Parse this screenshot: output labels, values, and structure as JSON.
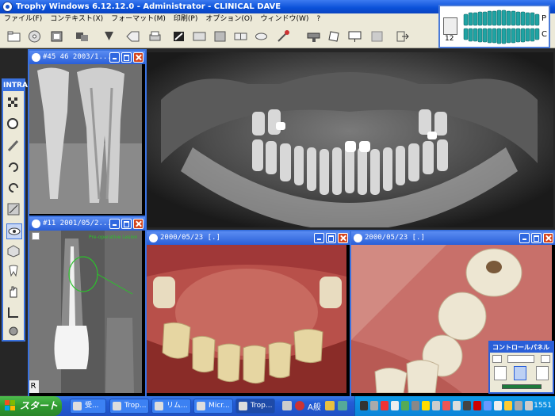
{
  "app": {
    "title": "Trophy Windows 6.12.12.0 - Administrator - CLINICAL DAVE"
  },
  "menu": [
    "ファイル(F)",
    "コンテキスト(X)",
    "フォーマット(M)",
    "印刷(P)",
    "オプション(O)",
    "ウィンドウ(W)",
    "?"
  ],
  "chart_panel": {
    "number": "12",
    "upper_label": "P",
    "lower_label": "C"
  },
  "intra": {
    "title": "INTRA"
  },
  "windows": {
    "xray_45": {
      "title": "#45 46 2003/1..."
    },
    "xray_11": {
      "title": "#11 2001/05/2...",
      "annotation": "Pre-operative Lesion",
      "corner_label": "R"
    },
    "photo_1": {
      "title": "2000/05/23 [.]"
    },
    "photo_2": {
      "title": "2000/05/23 [.]"
    }
  },
  "control_panel": {
    "title": "コントロールパネル"
  },
  "taskbar": {
    "start_label": "スタート",
    "tasks": [
      "受...",
      "Trop...",
      "リム...",
      "Micr...",
      "Trop..."
    ],
    "ime_label": "A般",
    "clock": "1551"
  },
  "colors": {
    "titlebar": "#0a50d8",
    "window_border": "#3a72e0",
    "chrome": "#ece9d8",
    "start": "#2f9a2f",
    "tray": "#0b84d8"
  }
}
